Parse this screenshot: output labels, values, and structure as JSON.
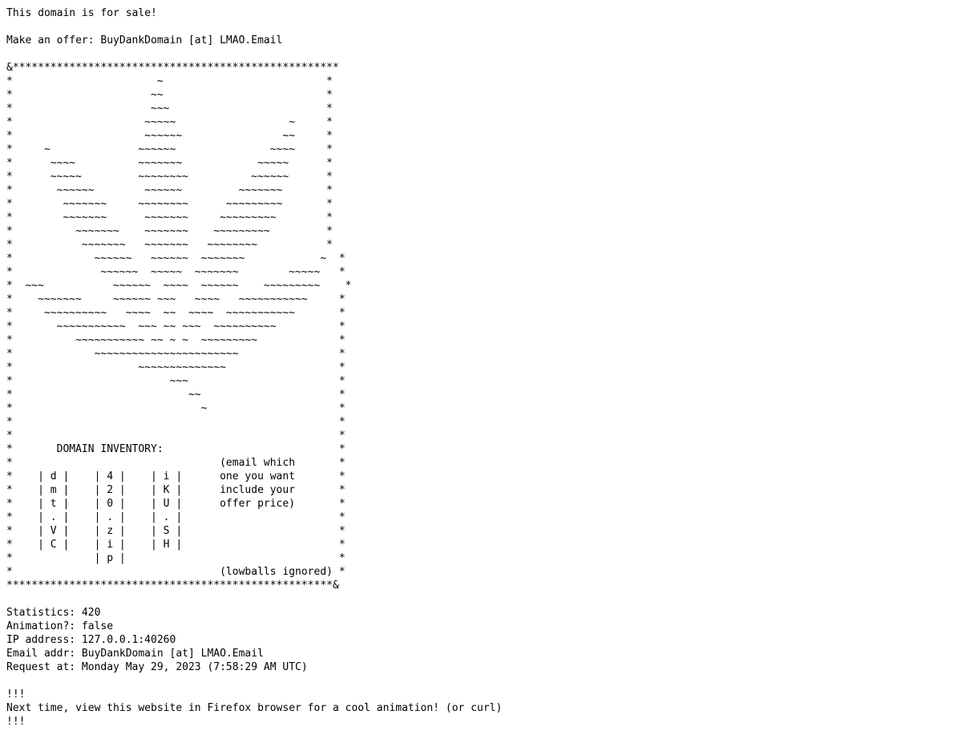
{
  "header": {
    "for_sale": "This domain is for sale!",
    "offer": "Make an offer: BuyDankDomain [at] LMAO.Email"
  },
  "art": {
    "top_border": "&****************************************************",
    "lines": [
      "*                       ~                          *",
      "*                      ~~                          *",
      "*                      ~~~                         *",
      "*                     ~~~~~                  ~     *",
      "*                     ~~~~~~                ~~     *",
      "*     ~              ~~~~~~               ~~~~     *",
      "*      ~~~~          ~~~~~~~            ~~~~~      *",
      "*      ~~~~~         ~~~~~~~~          ~~~~~~      *",
      "*       ~~~~~~        ~~~~~~         ~~~~~~~       *",
      "*        ~~~~~~~     ~~~~~~~~      ~~~~~~~~~       *",
      "*        ~~~~~~~      ~~~~~~~     ~~~~~~~~~        *",
      "*          ~~~~~~~    ~~~~~~~    ~~~~~~~~~         *",
      "*           ~~~~~~~   ~~~~~~~   ~~~~~~~~           *",
      "*             ~~~~~~   ~~~~~~  ~~~~~~~            ~  *",
      "*              ~~~~~~  ~~~~~  ~~~~~~~        ~~~~~   *",
      "*  ~~~           ~~~~~~  ~~~~  ~~~~~~    ~~~~~~~~~    *",
      "*    ~~~~~~~     ~~~~~~ ~~~   ~~~~   ~~~~~~~~~~~     *",
      "*     ~~~~~~~~~~   ~~~~  ~~  ~~~~  ~~~~~~~~~~~       *",
      "*       ~~~~~~~~~~~  ~~~ ~~ ~~~  ~~~~~~~~~~          *",
      "*          ~~~~~~~~~~~ ~~ ~ ~  ~~~~~~~~~             *",
      "*             ~~~~~~~~~~~~~~~~~~~~~~~                *",
      "*                    ~~~~~~~~~~~~~~                  *",
      "*                         ~~~                        *",
      "*                            ~~                      *",
      "*                              ~                     *",
      "*                                                    *",
      "*                                                    *",
      "*       DOMAIN INVENTORY:                            *",
      "*                                 (email which       *",
      "*    | d |    | 4 |    | i |      one you want       *",
      "*    | m |    | 2 |    | K |      include your       *",
      "*    | t |    | 0 |    | U |      offer price)       *",
      "*    | . |    | . |    | . |                         *",
      "*    | V |    | z |    | S |                         *",
      "*    | C |    | i |    | H |                         *",
      "*             | p |                                  *",
      "*                                 (lowballs ignored) *"
    ],
    "bottom_border": "****************************************************&"
  },
  "stats": {
    "statistics": "Statistics: 420",
    "animation": "Animation?: false",
    "ip": "IP address: 127.0.0.1:40260",
    "email": "Email addr: BuyDankDomain [at] LMAO.Email",
    "request": "Request at: Monday May 29, 2023 (7:58:29 AM UTC)"
  },
  "footer": {
    "bang_top": "!!!",
    "message": "Next time, view this website in Firefox browser for a cool animation! (or curl)",
    "bang_bottom": "!!!"
  }
}
